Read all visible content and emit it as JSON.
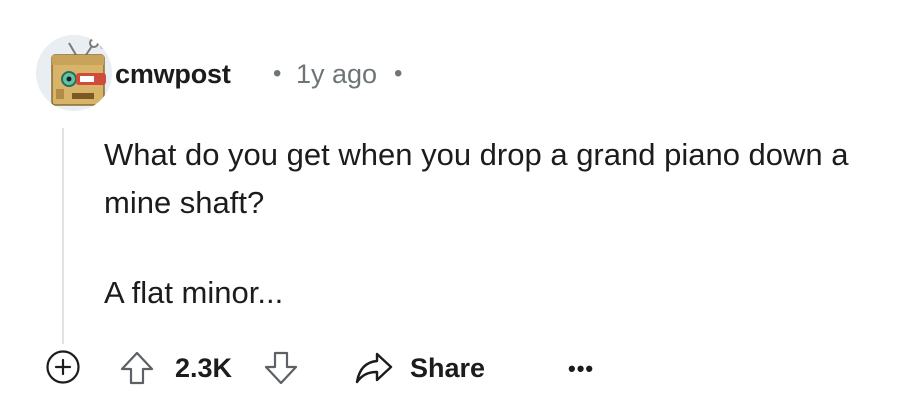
{
  "comment": {
    "author": "cmwpost",
    "separator": "•",
    "timestamp": "1y ago",
    "body_lines": [
      "What do you get when you drop a grand piano down a mine shaft?",
      "A flat minor..."
    ],
    "score": "2.3K",
    "share_label": "Share",
    "more_label": "•••"
  },
  "icons": {
    "expand": "plus-circle-icon",
    "upvote": "arrow-up-icon",
    "downvote": "arrow-down-icon",
    "share": "share-arrow-icon",
    "more": "ellipsis-icon"
  },
  "colors": {
    "text": "#1c1c1c",
    "meta": "#6e7578",
    "thread_line": "#dfe3e6",
    "avatar_bg": "#e9eef3"
  }
}
